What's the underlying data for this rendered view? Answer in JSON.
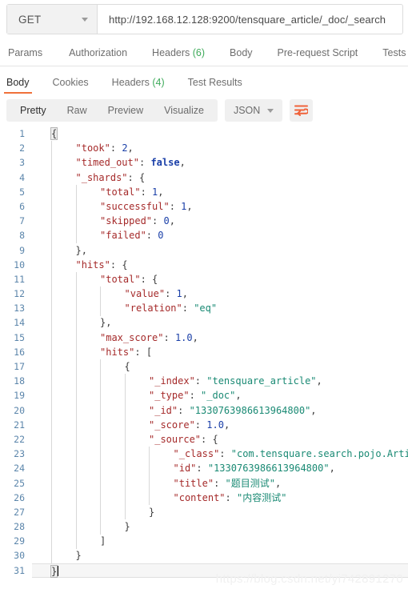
{
  "request": {
    "method": "GET",
    "url": "http://192.168.12.128:9200/tensquare_article/_doc/_search",
    "tabs": [
      {
        "label": "Params",
        "count": null
      },
      {
        "label": "Authorization",
        "count": null
      },
      {
        "label": "Headers",
        "count": "(6)"
      },
      {
        "label": "Body",
        "count": null
      },
      {
        "label": "Pre-request Script",
        "count": null
      },
      {
        "label": "Tests",
        "count": null
      }
    ]
  },
  "response": {
    "tabs": [
      {
        "label": "Body",
        "count": null,
        "active": true
      },
      {
        "label": "Cookies",
        "count": null,
        "active": false
      },
      {
        "label": "Headers",
        "count": "(4)",
        "active": false
      },
      {
        "label": "Test Results",
        "count": null,
        "active": false
      }
    ],
    "toolbar": {
      "views": [
        "Pretty",
        "Raw",
        "Preview",
        "Visualize"
      ],
      "active_view": "Pretty",
      "format": "JSON",
      "wrap_icon": "word-wrap-icon",
      "caret_icon": "chevron-down-icon"
    },
    "body_lines": [
      {
        "n": 1,
        "indent": 0,
        "segs": [
          {
            "t": "brace",
            "v": "{",
            "hl": true
          }
        ]
      },
      {
        "n": 2,
        "indent": 1,
        "segs": [
          {
            "t": "key",
            "v": "\"took\""
          },
          {
            "t": "punct",
            "v": ": "
          },
          {
            "t": "num",
            "v": "2"
          },
          {
            "t": "punct",
            "v": ","
          }
        ]
      },
      {
        "n": 3,
        "indent": 1,
        "segs": [
          {
            "t": "key",
            "v": "\"timed_out\""
          },
          {
            "t": "punct",
            "v": ": "
          },
          {
            "t": "bool",
            "v": "false"
          },
          {
            "t": "punct",
            "v": ","
          }
        ]
      },
      {
        "n": 4,
        "indent": 1,
        "segs": [
          {
            "t": "key",
            "v": "\"_shards\""
          },
          {
            "t": "punct",
            "v": ": "
          },
          {
            "t": "brace",
            "v": "{"
          }
        ]
      },
      {
        "n": 5,
        "indent": 2,
        "segs": [
          {
            "t": "key",
            "v": "\"total\""
          },
          {
            "t": "punct",
            "v": ": "
          },
          {
            "t": "num",
            "v": "1"
          },
          {
            "t": "punct",
            "v": ","
          }
        ]
      },
      {
        "n": 6,
        "indent": 2,
        "segs": [
          {
            "t": "key",
            "v": "\"successful\""
          },
          {
            "t": "punct",
            "v": ": "
          },
          {
            "t": "num",
            "v": "1"
          },
          {
            "t": "punct",
            "v": ","
          }
        ]
      },
      {
        "n": 7,
        "indent": 2,
        "segs": [
          {
            "t": "key",
            "v": "\"skipped\""
          },
          {
            "t": "punct",
            "v": ": "
          },
          {
            "t": "num",
            "v": "0"
          },
          {
            "t": "punct",
            "v": ","
          }
        ]
      },
      {
        "n": 8,
        "indent": 2,
        "segs": [
          {
            "t": "key",
            "v": "\"failed\""
          },
          {
            "t": "punct",
            "v": ": "
          },
          {
            "t": "num",
            "v": "0"
          }
        ]
      },
      {
        "n": 9,
        "indent": 1,
        "segs": [
          {
            "t": "brace",
            "v": "},"
          }
        ]
      },
      {
        "n": 10,
        "indent": 1,
        "segs": [
          {
            "t": "key",
            "v": "\"hits\""
          },
          {
            "t": "punct",
            "v": ": "
          },
          {
            "t": "brace",
            "v": "{"
          }
        ]
      },
      {
        "n": 11,
        "indent": 2,
        "segs": [
          {
            "t": "key",
            "v": "\"total\""
          },
          {
            "t": "punct",
            "v": ": "
          },
          {
            "t": "brace",
            "v": "{"
          }
        ]
      },
      {
        "n": 12,
        "indent": 3,
        "segs": [
          {
            "t": "key",
            "v": "\"value\""
          },
          {
            "t": "punct",
            "v": ": "
          },
          {
            "t": "num",
            "v": "1"
          },
          {
            "t": "punct",
            "v": ","
          }
        ]
      },
      {
        "n": 13,
        "indent": 3,
        "segs": [
          {
            "t": "key",
            "v": "\"relation\""
          },
          {
            "t": "punct",
            "v": ": "
          },
          {
            "t": "str",
            "v": "\"eq\""
          }
        ]
      },
      {
        "n": 14,
        "indent": 2,
        "segs": [
          {
            "t": "brace",
            "v": "},"
          }
        ]
      },
      {
        "n": 15,
        "indent": 2,
        "segs": [
          {
            "t": "key",
            "v": "\"max_score\""
          },
          {
            "t": "punct",
            "v": ": "
          },
          {
            "t": "num",
            "v": "1.0"
          },
          {
            "t": "punct",
            "v": ","
          }
        ]
      },
      {
        "n": 16,
        "indent": 2,
        "segs": [
          {
            "t": "key",
            "v": "\"hits\""
          },
          {
            "t": "punct",
            "v": ": "
          },
          {
            "t": "brace",
            "v": "["
          }
        ]
      },
      {
        "n": 17,
        "indent": 3,
        "segs": [
          {
            "t": "brace",
            "v": "{"
          }
        ]
      },
      {
        "n": 18,
        "indent": 4,
        "segs": [
          {
            "t": "key",
            "v": "\"_index\""
          },
          {
            "t": "punct",
            "v": ": "
          },
          {
            "t": "str",
            "v": "\"tensquare_article\""
          },
          {
            "t": "punct",
            "v": ","
          }
        ]
      },
      {
        "n": 19,
        "indent": 4,
        "segs": [
          {
            "t": "key",
            "v": "\"_type\""
          },
          {
            "t": "punct",
            "v": ": "
          },
          {
            "t": "str",
            "v": "\"_doc\""
          },
          {
            "t": "punct",
            "v": ","
          }
        ]
      },
      {
        "n": 20,
        "indent": 4,
        "segs": [
          {
            "t": "key",
            "v": "\"_id\""
          },
          {
            "t": "punct",
            "v": ": "
          },
          {
            "t": "str",
            "v": "\"1330763986613964800\""
          },
          {
            "t": "punct",
            "v": ","
          }
        ]
      },
      {
        "n": 21,
        "indent": 4,
        "segs": [
          {
            "t": "key",
            "v": "\"_score\""
          },
          {
            "t": "punct",
            "v": ": "
          },
          {
            "t": "num",
            "v": "1.0"
          },
          {
            "t": "punct",
            "v": ","
          }
        ]
      },
      {
        "n": 22,
        "indent": 4,
        "segs": [
          {
            "t": "key",
            "v": "\"_source\""
          },
          {
            "t": "punct",
            "v": ": "
          },
          {
            "t": "brace",
            "v": "{"
          }
        ]
      },
      {
        "n": 23,
        "indent": 5,
        "segs": [
          {
            "t": "key",
            "v": "\"_class\""
          },
          {
            "t": "punct",
            "v": ": "
          },
          {
            "t": "str",
            "v": "\"com.tensquare.search.pojo.Article\""
          },
          {
            "t": "punct",
            "v": ","
          }
        ]
      },
      {
        "n": 24,
        "indent": 5,
        "segs": [
          {
            "t": "key",
            "v": "\"id\""
          },
          {
            "t": "punct",
            "v": ": "
          },
          {
            "t": "str",
            "v": "\"1330763986613964800\""
          },
          {
            "t": "punct",
            "v": ","
          }
        ]
      },
      {
        "n": 25,
        "indent": 5,
        "segs": [
          {
            "t": "key",
            "v": "\"title\""
          },
          {
            "t": "punct",
            "v": ": "
          },
          {
            "t": "str",
            "v": "\"题目测试\""
          },
          {
            "t": "punct",
            "v": ","
          }
        ]
      },
      {
        "n": 26,
        "indent": 5,
        "segs": [
          {
            "t": "key",
            "v": "\"content\""
          },
          {
            "t": "punct",
            "v": ": "
          },
          {
            "t": "str",
            "v": "\"内容测试\""
          }
        ]
      },
      {
        "n": 27,
        "indent": 4,
        "segs": [
          {
            "t": "brace",
            "v": "}"
          }
        ]
      },
      {
        "n": 28,
        "indent": 3,
        "segs": [
          {
            "t": "brace",
            "v": "}"
          }
        ]
      },
      {
        "n": 29,
        "indent": 2,
        "segs": [
          {
            "t": "brace",
            "v": "]"
          }
        ]
      },
      {
        "n": 30,
        "indent": 1,
        "segs": [
          {
            "t": "brace",
            "v": "}"
          }
        ]
      },
      {
        "n": 31,
        "indent": 0,
        "segs": [
          {
            "t": "brace",
            "v": "}",
            "hl": true,
            "cursor": true
          }
        ],
        "active": true
      }
    ]
  },
  "watermark": "https://blog.csdn.net/yi742891270"
}
